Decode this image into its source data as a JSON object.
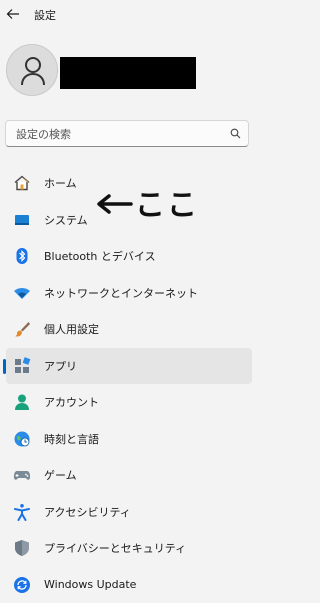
{
  "window": {
    "title": "設定"
  },
  "search": {
    "placeholder": "設定の検索"
  },
  "nav": {
    "items": [
      {
        "label": "ホーム",
        "icon": "home-icon"
      },
      {
        "label": "システム",
        "icon": "system-icon"
      },
      {
        "label": "Bluetooth とデバイス",
        "icon": "bluetooth-icon"
      },
      {
        "label": "ネットワークとインターネット",
        "icon": "network-icon"
      },
      {
        "label": "個人用設定",
        "icon": "personalization-brush-icon"
      },
      {
        "label": "アプリ",
        "icon": "apps-icon",
        "selected": true
      },
      {
        "label": "アカウント",
        "icon": "account-icon"
      },
      {
        "label": "時刻と言語",
        "icon": "time-language-icon"
      },
      {
        "label": "ゲーム",
        "icon": "gamepad-icon"
      },
      {
        "label": "アクセシビリティ",
        "icon": "accessibility-icon"
      },
      {
        "label": "プライバシーとセキュリティ",
        "icon": "shield-icon"
      },
      {
        "label": "Windows Update",
        "icon": "windows-update-icon"
      }
    ]
  },
  "annotation": {
    "text": "ここ"
  },
  "colors": {
    "accent": "#0067c0",
    "selected_bg": "#e5e5e5",
    "background": "#f3f3f3"
  }
}
